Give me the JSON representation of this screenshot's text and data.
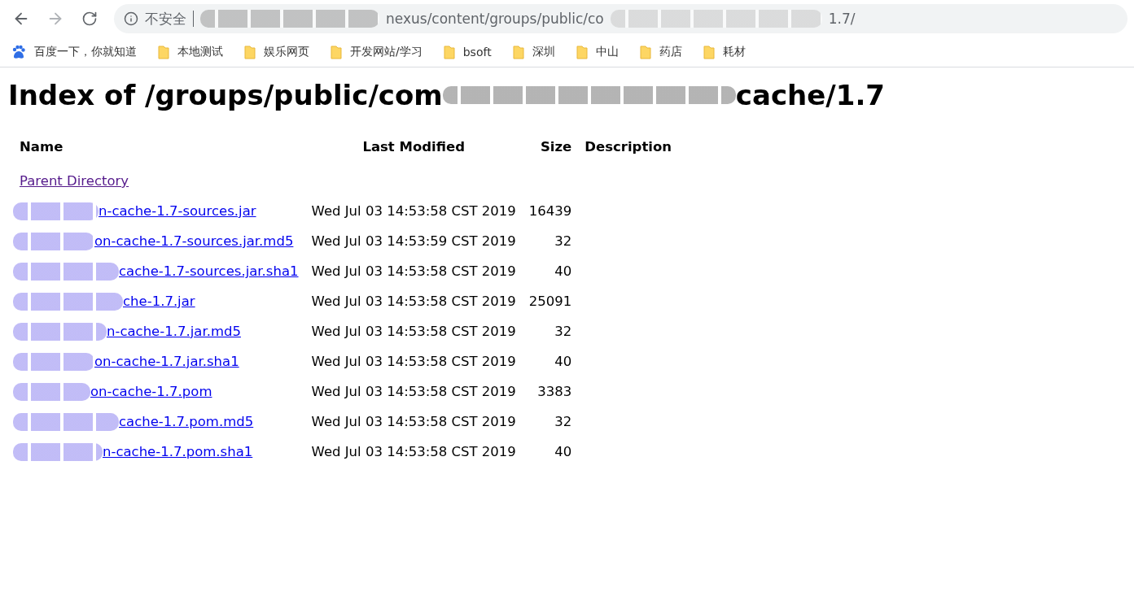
{
  "toolbar": {
    "back": {
      "disabled": false
    },
    "forward": {
      "disabled": true
    },
    "security_label": "不安全",
    "url_start": "nexus/content/groups/public/co",
    "url_end": "1.7/"
  },
  "bookmarks": [
    {
      "kind": "site",
      "label": "百度一下，你就知道"
    },
    {
      "kind": "folder",
      "label": "本地测试"
    },
    {
      "kind": "folder",
      "label": "娱乐网页"
    },
    {
      "kind": "folder",
      "label": "开发网站/学习"
    },
    {
      "kind": "folder",
      "label": "bsoft"
    },
    {
      "kind": "folder",
      "label": "深圳"
    },
    {
      "kind": "folder",
      "label": "中山"
    },
    {
      "kind": "folder",
      "label": "药店"
    },
    {
      "kind": "folder",
      "label": "耗材"
    }
  ],
  "page": {
    "title_start": "Index of /groups/public/com",
    "title_end": "cache/1.7",
    "columns": [
      "Name",
      "Last Modified",
      "Size",
      "Description"
    ],
    "parent": {
      "label": "Parent Directory",
      "visited": true
    },
    "rows": [
      {
        "name": "n-cache-1.7-sources.jar",
        "visited": false,
        "modified": "Wed Jul 03 14:53:58 CST 2019",
        "size": "16439"
      },
      {
        "name": "on-cache-1.7-sources.jar.md5",
        "visited": false,
        "modified": "Wed Jul 03 14:53:59 CST 2019",
        "size": "32"
      },
      {
        "name": "cache-1.7-sources.jar.sha1",
        "visited": false,
        "modified": "Wed Jul 03 14:53:58 CST 2019",
        "size": "40"
      },
      {
        "name": "che-1.7.jar",
        "visited": false,
        "modified": "Wed Jul 03 14:53:58 CST 2019",
        "size": "25091"
      },
      {
        "name": "n-cache-1.7.jar.md5",
        "visited": false,
        "modified": "Wed Jul 03 14:53:58 CST 2019",
        "size": "32"
      },
      {
        "name": "on-cache-1.7.jar.sha1",
        "visited": false,
        "modified": "Wed Jul 03 14:53:58 CST 2019",
        "size": "40"
      },
      {
        "name": "on-cache-1.7.pom",
        "visited": false,
        "modified": "Wed Jul 03 14:53:58 CST 2019",
        "size": "3383"
      },
      {
        "name": "cache-1.7.pom.md5",
        "visited": false,
        "modified": "Wed Jul 03 14:53:58 CST 2019",
        "size": "32"
      },
      {
        "name": "n-cache-1.7.pom.sha1",
        "visited": false,
        "modified": "Wed Jul 03 14:53:58 CST 2019",
        "size": "40"
      }
    ]
  }
}
